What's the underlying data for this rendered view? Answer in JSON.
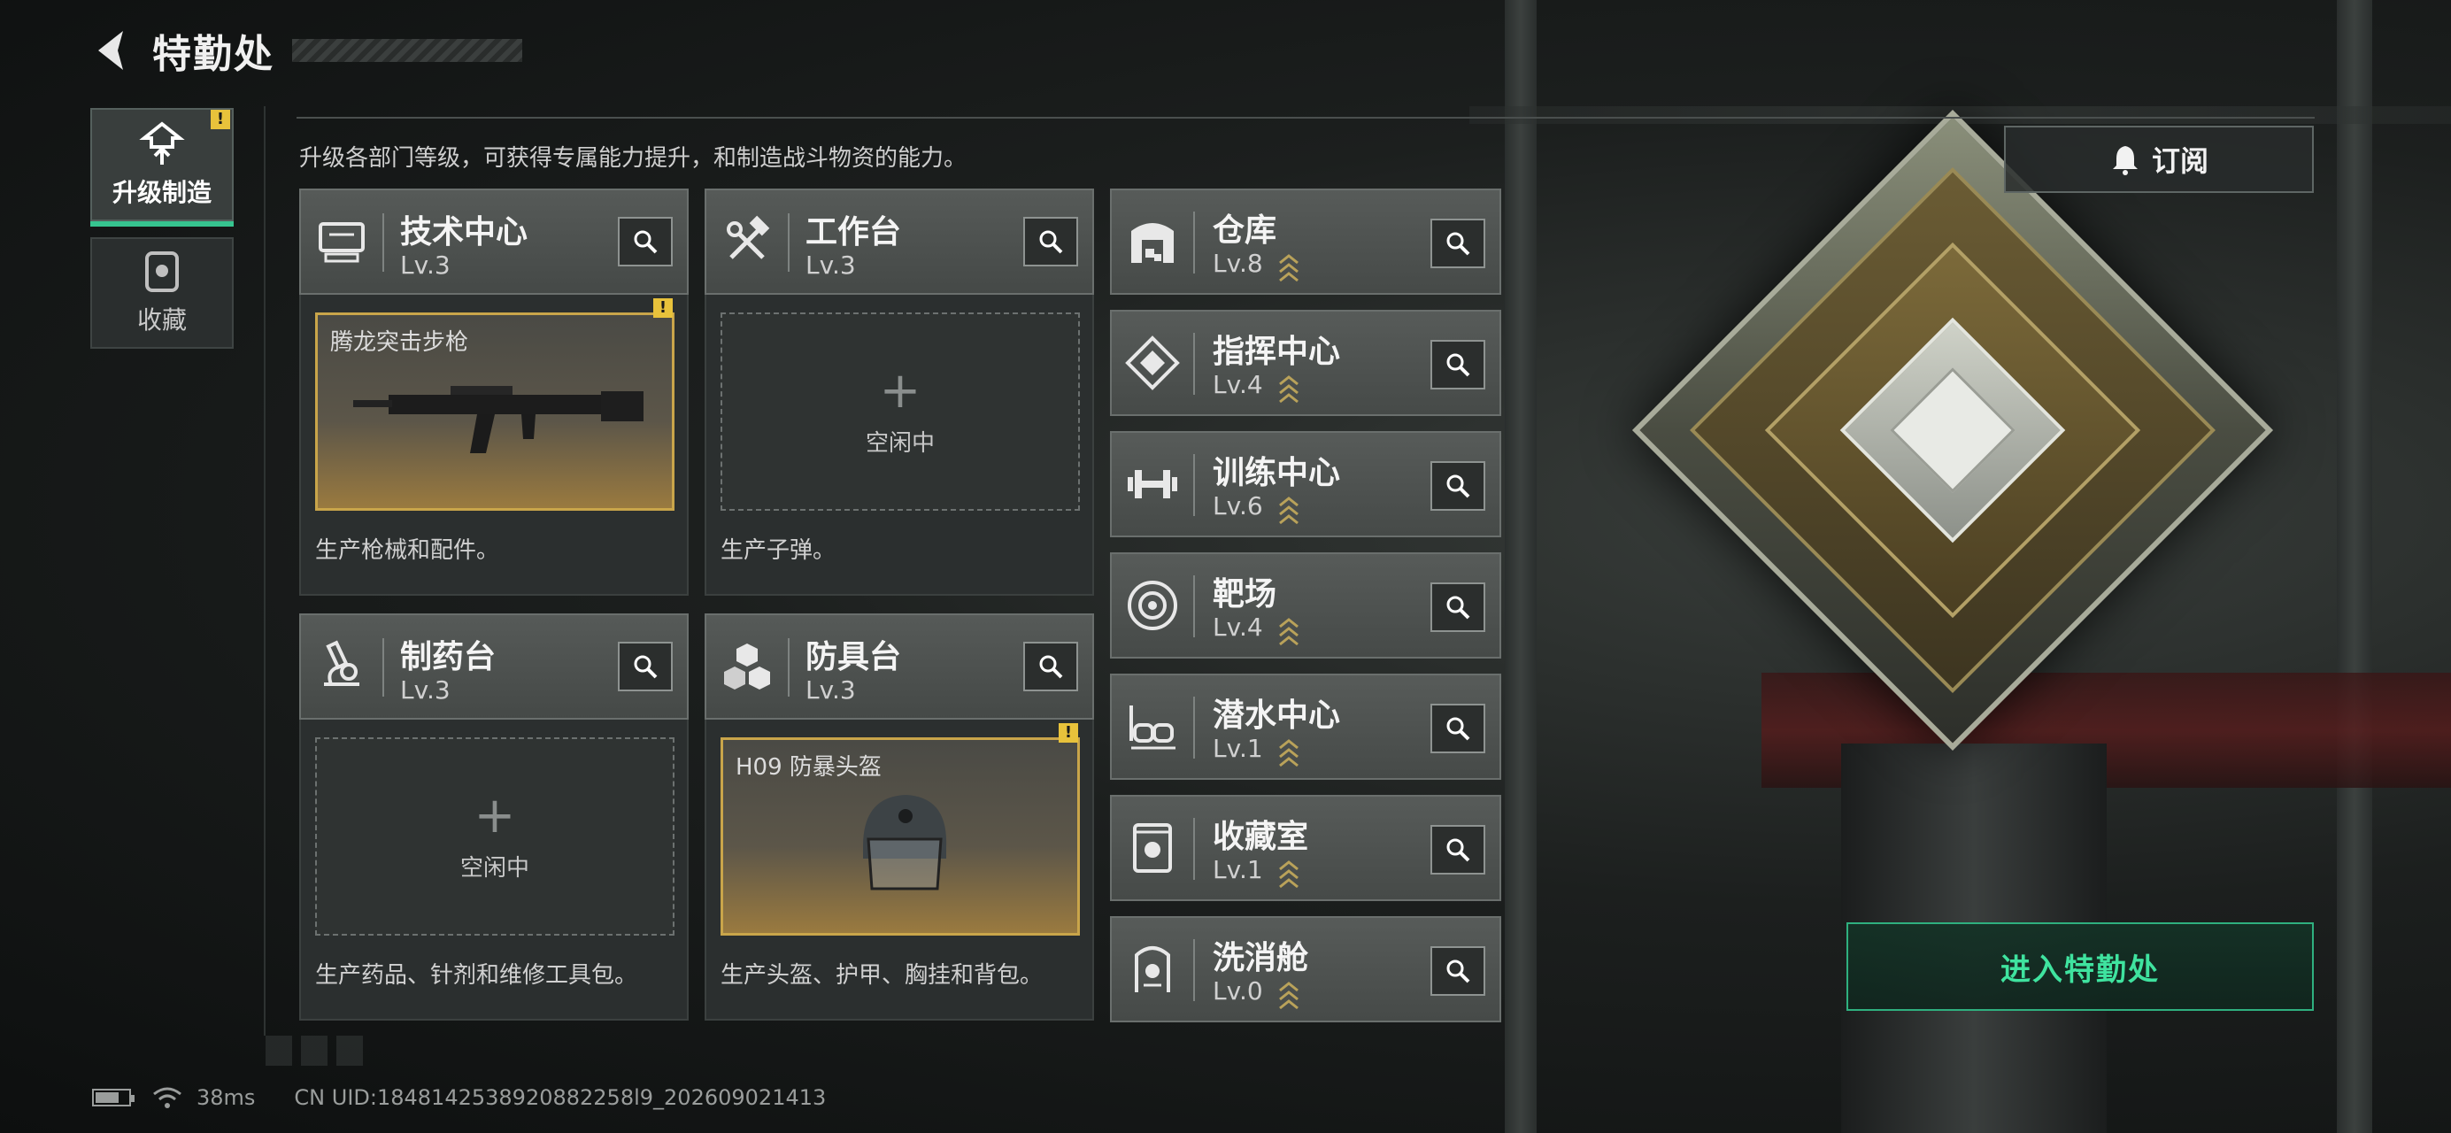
{
  "header": {
    "title": "特勤处",
    "description": "升级各部门等级，可获得专属能力提升，和制造战斗物资的能力。"
  },
  "tabs": [
    {
      "label": "升级制造",
      "active": true,
      "alert": "!"
    },
    {
      "label": "收藏",
      "active": false
    }
  ],
  "facilities": [
    {
      "name": "技术中心",
      "level": "Lv.3",
      "slot_status": "filled",
      "slot_item": "腾龙突击步枪",
      "slot_alert": "!",
      "caption": "生产枪械和配件。",
      "icon": "monitor-icon"
    },
    {
      "name": "工作台",
      "level": "Lv.3",
      "slot_status": "empty",
      "slot_plus": "+",
      "slot_idle": "空闲中",
      "caption": "生产子弹。",
      "icon": "hammer-wrench-icon"
    },
    {
      "name": "制药台",
      "level": "Lv.3",
      "slot_status": "empty",
      "slot_plus": "+",
      "slot_idle": "空闲中",
      "caption": "生产药品、针剂和维修工具包。",
      "icon": "microscope-icon"
    },
    {
      "name": "防具台",
      "level": "Lv.3",
      "slot_status": "filled",
      "slot_item": "H09 防暴头盔",
      "slot_alert": "!",
      "caption": "生产头盔、护甲、胸挂和背包。",
      "icon": "blocks-icon"
    }
  ],
  "side_facilities": [
    {
      "name": "仓库",
      "level": "Lv.8",
      "icon": "warehouse-icon"
    },
    {
      "name": "指挥中心",
      "level": "Lv.4",
      "icon": "command-icon"
    },
    {
      "name": "训练中心",
      "level": "Lv.6",
      "icon": "dumbbell-icon"
    },
    {
      "name": "靶场",
      "level": "Lv.4",
      "icon": "target-icon"
    },
    {
      "name": "潜水中心",
      "level": "Lv.1",
      "icon": "diving-mask-icon"
    },
    {
      "name": "收藏室",
      "level": "Lv.1",
      "icon": "display-case-icon"
    },
    {
      "name": "洗消舱",
      "level": "Lv.0",
      "icon": "decon-icon"
    }
  ],
  "buttons": {
    "subscribe": "订阅",
    "enter": "进入特勤处"
  },
  "status_bar": {
    "ping": "38ms",
    "uid": "CN UID:1848142538920882258l9_202609021413"
  },
  "colors": {
    "accent_green": "#3fe39f",
    "alert_yellow": "#e8c23b",
    "slot_gold": "#c9a54a"
  }
}
